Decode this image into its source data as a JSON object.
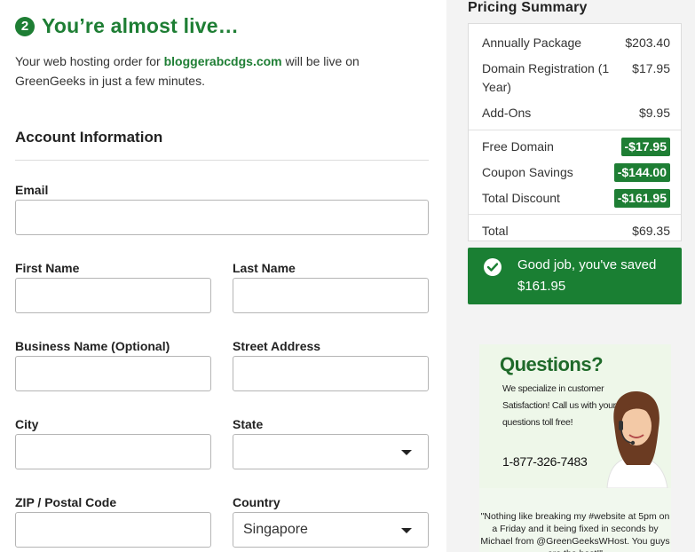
{
  "header": {
    "step_number": "2",
    "title": "You’re almost live…",
    "intro_prefix": "Your web hosting order for ",
    "intro_domain": "bloggerabcdgs.com",
    "intro_suffix": " will be live on GreenGeeks in just a few minutes."
  },
  "account": {
    "section_title": "Account Information",
    "fields": {
      "email": {
        "label": "Email",
        "value": ""
      },
      "first_name": {
        "label": "First Name",
        "value": ""
      },
      "last_name": {
        "label": "Last Name",
        "value": ""
      },
      "business_name": {
        "label": "Business Name (Optional)",
        "value": ""
      },
      "street_address": {
        "label": "Street Address",
        "value": ""
      },
      "city": {
        "label": "City",
        "value": ""
      },
      "state": {
        "label": "State",
        "value": ""
      },
      "zip": {
        "label": "ZIP / Postal Code",
        "value": ""
      },
      "country": {
        "label": "Country",
        "value": "Singapore"
      }
    }
  },
  "pricing": {
    "title": "Pricing Summary",
    "rows": [
      {
        "label": "Annually Package",
        "amount": "$203.40"
      },
      {
        "label": "Domain Registration (1 Year)",
        "amount": "$17.95"
      },
      {
        "label": "Add-Ons",
        "amount": "$9.95"
      }
    ],
    "discounts": [
      {
        "label": "Free Domain",
        "amount": "-$17.95"
      },
      {
        "label": "Coupon Savings",
        "amount": "-$144.00"
      },
      {
        "label": "Total Discount",
        "amount": "-$161.95"
      }
    ],
    "total": {
      "label": "Total",
      "amount": "$69.35"
    },
    "saved_message": "Good job, you've saved $161.95"
  },
  "ad": {
    "heading": "Questions?",
    "text": "We specialize in customer Satisfaction! Call us with your questions toll free!",
    "phone": "1-877-326-7483",
    "quote": "\"Nothing like breaking my #website at 5pm on a Friday and it being fixed in seconds by Michael from @GreenGeeksWHost. You guys are the best!\""
  },
  "colors": {
    "brand_green": "#1e7e34",
    "sidebar_bg": "#f3f3f3"
  }
}
